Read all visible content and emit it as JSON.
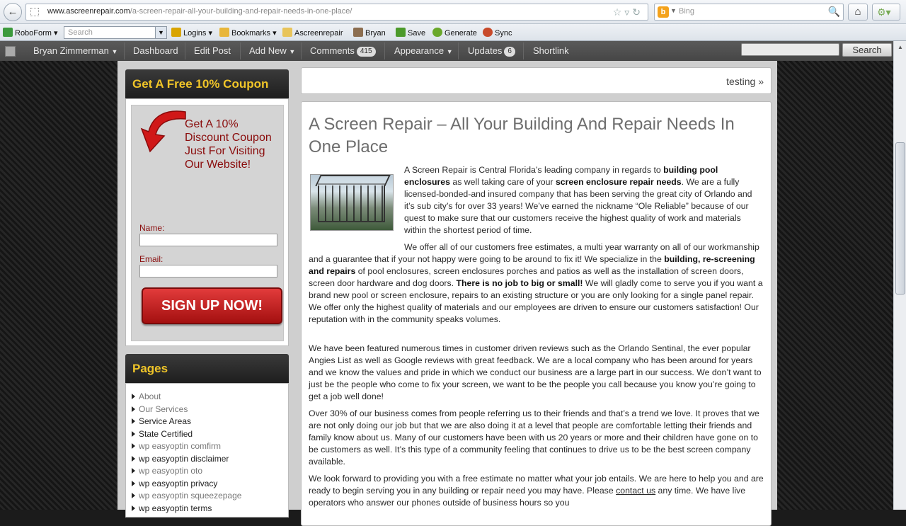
{
  "browser": {
    "url_domain": "www.ascreenrepair.com",
    "url_path": "/a-screen-repair-all-your-building-and-repair-needs-in-one-place/",
    "search_engine": "Bing",
    "search_placeholder": "Bing"
  },
  "toolbar": {
    "items": [
      "RoboForm",
      "Logins",
      "Bookmarks",
      "Ascreenrepair",
      "Bryan",
      "Save",
      "Generate",
      "Sync"
    ],
    "search_placeholder": "Search"
  },
  "adminbar": {
    "user": "Bryan Zimmerman",
    "dashboard": "Dashboard",
    "edit_post": "Edit Post",
    "add_new": "Add New",
    "comments": "Comments",
    "comments_count": "415",
    "appearance": "Appearance",
    "updates": "Updates",
    "updates_count": "6",
    "shortlink": "Shortlink",
    "search_button": "Search"
  },
  "sidebar": {
    "coupon_title": "Get A Free 10% Coupon",
    "coupon_text": "Get A 10% Discount Coupon Just For Visiting Our Website!",
    "name_label": "Name:",
    "email_label": "Email:",
    "signup_label": "SIGN UP NOW!",
    "pages_title": "Pages",
    "pages": [
      {
        "label": "About",
        "style": "dim"
      },
      {
        "label": "Our Services",
        "style": "dim"
      },
      {
        "label": "Service Areas",
        "style": "dark"
      },
      {
        "label": "State Certified",
        "style": "dark"
      },
      {
        "label": "wp easyoptin comfirm",
        "style": "dim"
      },
      {
        "label": "wp easyoptin disclaimer",
        "style": "dark"
      },
      {
        "label": "wp easyoptin oto",
        "style": "dim"
      },
      {
        "label": "wp easyoptin privacy",
        "style": "dark"
      },
      {
        "label": "wp easyoptin squeezepage",
        "style": "dim"
      },
      {
        "label": "wp easyoptin terms",
        "style": "dark"
      }
    ]
  },
  "main": {
    "crumb": "testing »",
    "title": "A Screen Repair – All Your Building And Repair Needs In One Place",
    "p1_a": "A Screen Repair is Central Florida’s leading company in regards to ",
    "p1_b": "building pool enclosures",
    "p1_c": " as well taking care of  your ",
    "p1_d": "screen enclosure repair needs",
    "p1_e": ".  We  are a fully licensed-bonded-and insured company that has been serving the great city of Orlando and it’s sub city’s for over 33 years!  We’ve earned the nickname “Ole Reliable”  because of our quest to make sure that our customers receive the highest quality of work and materials within the shortest period of time.",
    "p2_a": "We offer all of our customers free estimates, a multi year warranty on all of our workmanship and a guarantee that if your not happy were going to be around to fix it!  We specialize in the ",
    "p2_b": "building,  re-screening and repairs",
    "p2_c": " of pool enclosures, screen enclosures porches and patios as well as the installation of screen doors, screen door hardware and dog doors.  ",
    "p2_d": "There is no job to big or small!",
    "p2_e": "  We will gladly come to serve you if you want a brand new pool or screen enclosure, repairs to an existing structure or you are only looking for a single panel repair.  We offer only the highest quality of materials and our employees are driven to ensure our customers satisfaction! Our reputation with in the community speaks volumes.",
    "p3": "We have been featured numerous times in customer driven reviews such as the Orlando Sentinal, the ever popular Angies List as well as Google reviews  with great feedback.  We are a local company who has been around for years and we know the values and pride in which we conduct our business are a large part in our success.  We don’t want to just be the people who come to fix your screen, we want to be the people you call because you know you’re going to get a job well done!",
    "p4": "Over 30% of our business comes from people referring us to their friends and that’s a trend we love.  It proves that we are not only doing our job but that we are also doing it at a level that people are comfortable letting their friends and family know about us.  Many of our customers have been with us 20 years or more and their children have gone on to be customers as well.  It’s this type of a community feeling that continues to drive us to be the best screen company available.",
    "p5_a": "We look forward to providing you with a free estimate no matter what your job entails.  We are here to help you and are ready to begin serving you in any building or repair need you may have.  Please ",
    "p5_link": "contact us",
    "p5_b": " any time.  We have live operators who answer our phones outside of business hours so you"
  }
}
